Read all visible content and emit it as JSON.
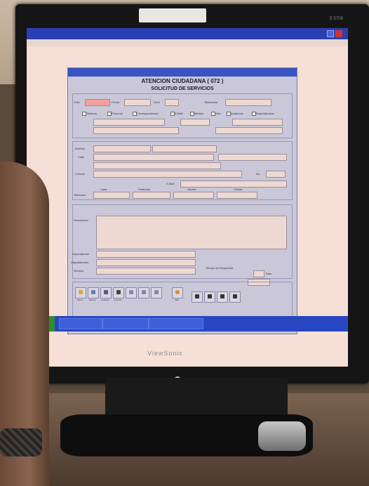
{
  "monitor": {
    "sticker_text": "",
    "brand": "ViewSonic",
    "model_tag": "E 5709"
  },
  "screen": {
    "app_title_left": "",
    "app_title_mid": "",
    "app_title_right": "",
    "menu_items": [
      "",
      "",
      "",
      "",
      ""
    ],
    "taskbar_items": [
      "",
      "",
      ""
    ],
    "clock": ""
  },
  "form": {
    "window_title": "",
    "heading": "ATENCION CIUDADANA ( 072 )",
    "subheading": "SOLICITUD DE SERVICIOS",
    "sections": {
      "solicitud": "",
      "solicitante": "",
      "descripcion": ""
    },
    "labels": {
      "folio": "Folio",
      "fecha": "Fecha",
      "hora": "Hora",
      "telefonista": "Telefonista",
      "nombre": "Nombre",
      "calle": "Calle",
      "colonia": "Colonia",
      "telefonos": "Telefonos",
      "email": "E-Mail",
      "no": "No.",
      "casa": "Casa",
      "particular": "Particular",
      "oficina": "Oficina",
      "celular": "Celular",
      "descripcion": "Descripcion",
      "dependencia": "Dependencia",
      "departamento": "Departamento",
      "servicio": "Servicio",
      "tiempo_respuesta": "Tiempo de Respuesta",
      "dias": "Dias"
    },
    "checkboxes": [
      "Telefono",
      "Personal",
      "Correspondencia",
      "E-Mail",
      "Medios",
      "Otro",
      "Audiencia",
      "Dependencias"
    ],
    "toolbar_buttons": [
      "Nuevo",
      "Buscar",
      "Guardar",
      "Imprimir",
      "",
      "",
      "",
      "Salir"
    ],
    "nav_buttons": [
      "",
      "",
      "",
      ""
    ],
    "side_links": [
      "",
      "",
      "",
      ""
    ]
  }
}
